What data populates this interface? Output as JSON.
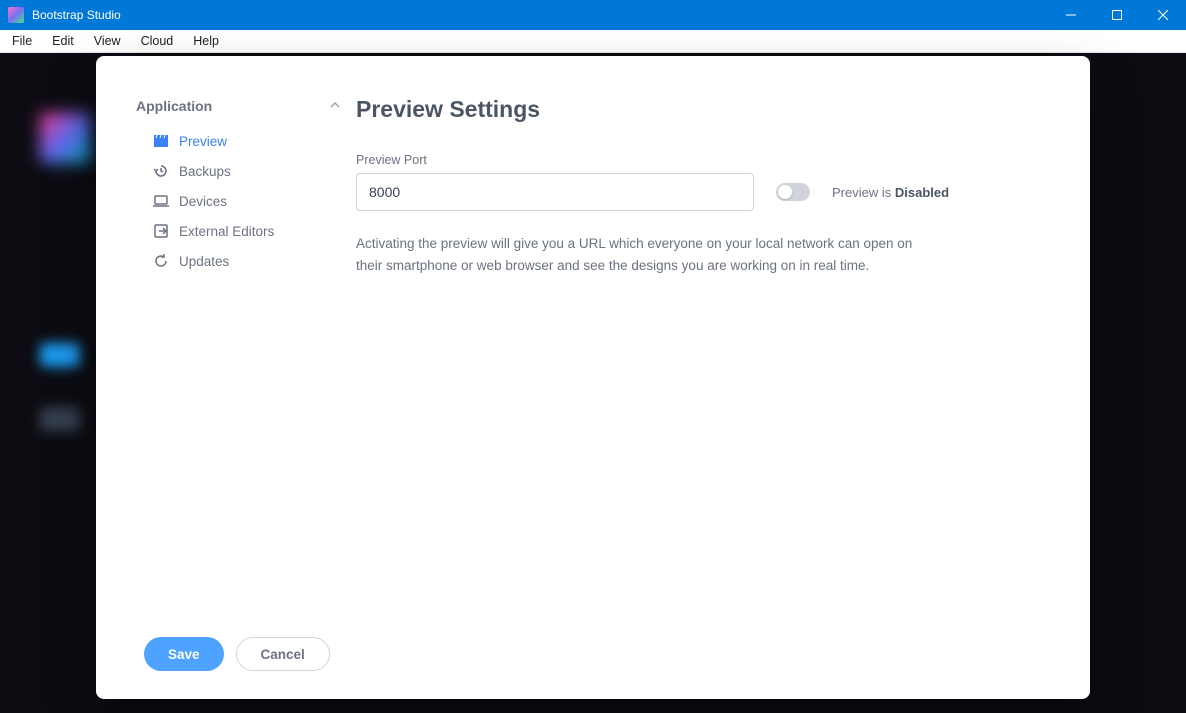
{
  "window": {
    "title": "Bootstrap Studio"
  },
  "menubar": {
    "items": [
      "File",
      "Edit",
      "View",
      "Cloud",
      "Help"
    ]
  },
  "sidebar": {
    "section_title": "Application",
    "items": [
      {
        "label": "Preview",
        "icon": "clapperboard-icon",
        "active": true
      },
      {
        "label": "Backups",
        "icon": "history-icon",
        "active": false
      },
      {
        "label": "Devices",
        "icon": "laptop-icon",
        "active": false
      },
      {
        "label": "External Editors",
        "icon": "export-icon",
        "active": false
      },
      {
        "label": "Updates",
        "icon": "refresh-icon",
        "active": false
      }
    ]
  },
  "content": {
    "title": "Preview Settings",
    "port_label": "Preview Port",
    "port_value": "8000",
    "toggle_prefix": "Preview is ",
    "toggle_state": "Disabled",
    "help_text": "Activating the preview will give you a URL which everyone on your local network can open on their smartphone or web browser and see the designs you are working on in real time."
  },
  "footer": {
    "save": "Save",
    "cancel": "Cancel"
  }
}
